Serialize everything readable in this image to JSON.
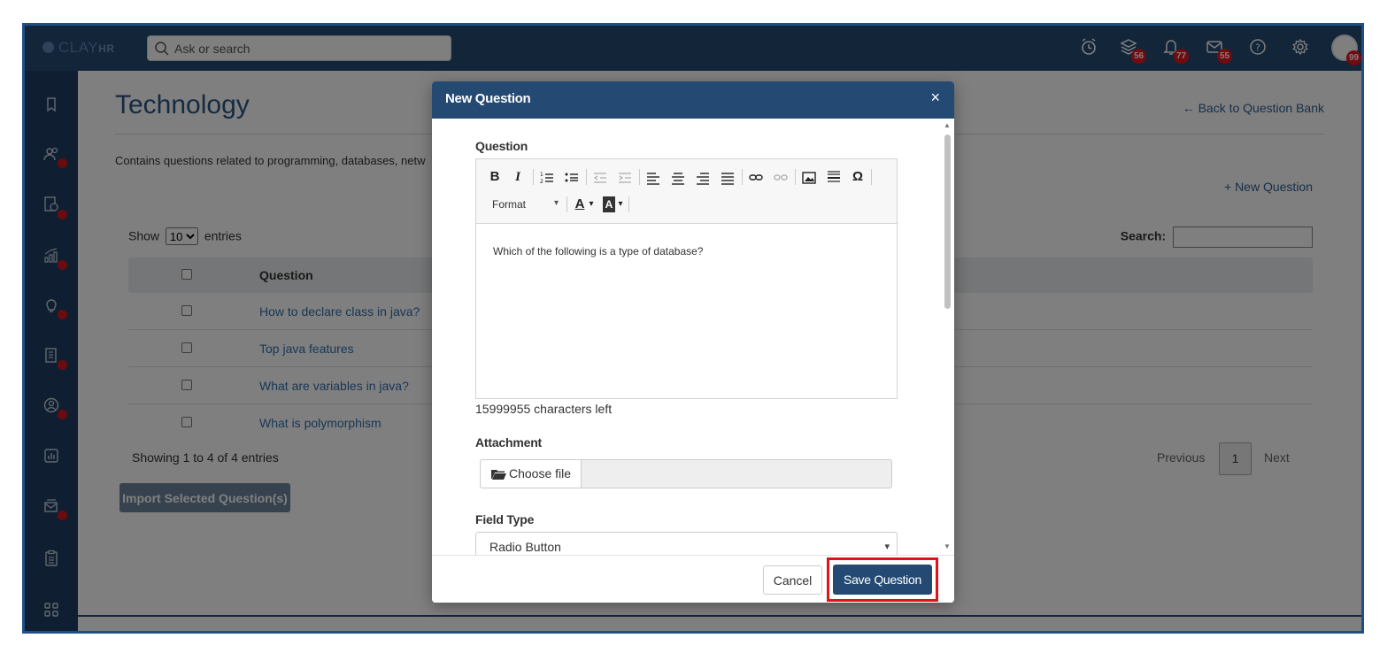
{
  "header": {
    "logo_text": "CLAY",
    "logo_suffix": "HR",
    "search_placeholder": "Ask or search",
    "badges": {
      "layers": "56",
      "notifications": "77",
      "messages": "55",
      "avatar": "99"
    }
  },
  "page": {
    "title": "Technology",
    "back_link": "← Back to Question Bank",
    "description": "Contains questions related to programming, databases, netw",
    "new_question_link": "+ New Question",
    "show_label": "Show",
    "entries_label": "entries",
    "page_size": "10",
    "search_label": "Search:",
    "column_question": "Question",
    "rows": [
      {
        "question": "How to declare class in java?"
      },
      {
        "question": "Top java features"
      },
      {
        "question": "What are variables in java?"
      },
      {
        "question": "What is polymorphism"
      }
    ],
    "showing_text": "Showing 1 to 4 of 4 entries",
    "import_button": "Import Selected Question(s)",
    "pagination": {
      "previous": "Previous",
      "current": "1",
      "next": "Next"
    }
  },
  "modal": {
    "title": "New Question",
    "close": "×",
    "question_label": "Question",
    "toolbar": {
      "bold": "B",
      "italic": "I",
      "special_char": "Ω",
      "format": "Format",
      "text_color": "A",
      "bg_color": "A"
    },
    "editor_text": "Which of the following is a type of database?",
    "chars_left": "15999955 characters left",
    "attachment_label": "Attachment",
    "choose_file": "Choose file",
    "field_type_label": "Field Type",
    "field_type_value": "Radio Button",
    "cancel_button": "Cancel",
    "save_button": "Save Question"
  },
  "colors": {
    "brand": "#244a73",
    "badge": "#e3161c",
    "link": "#2f6fad",
    "highlight": "#e1121a"
  }
}
